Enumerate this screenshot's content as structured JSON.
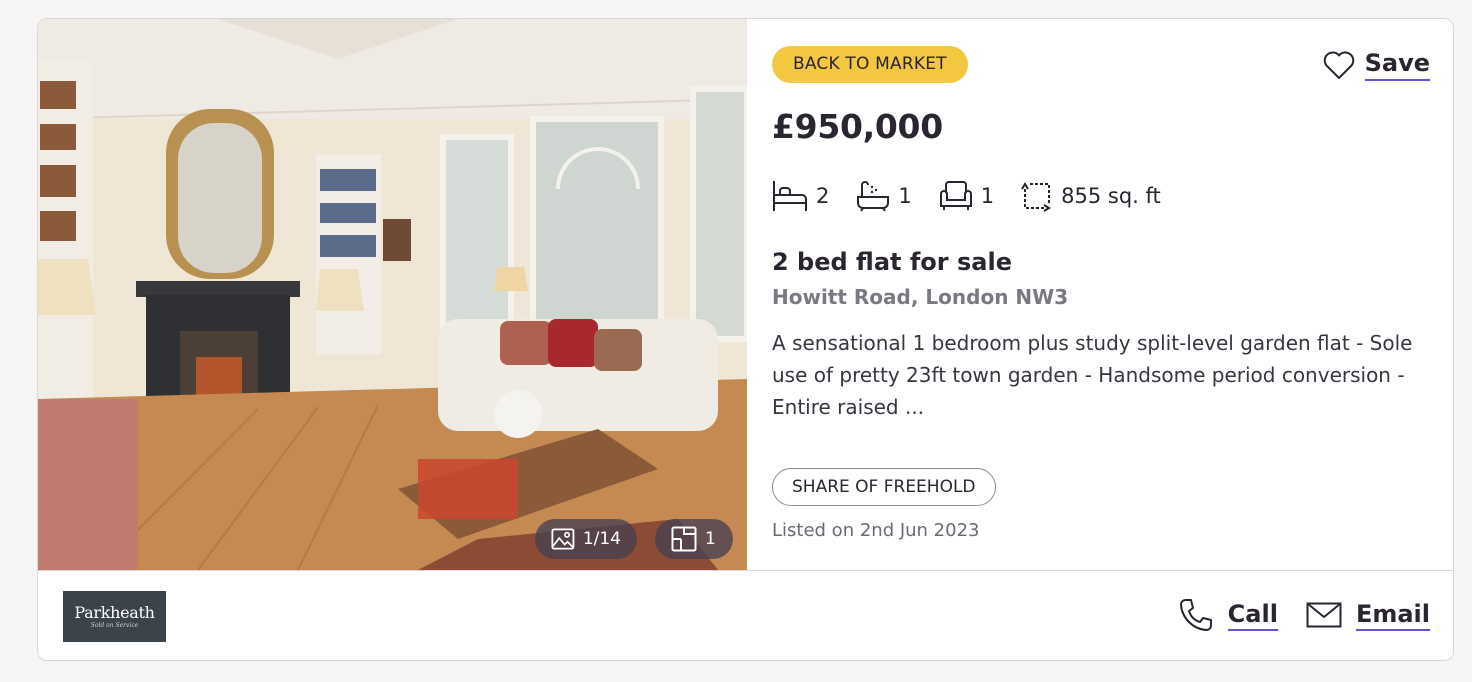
{
  "listing": {
    "badge": "BACK TO MARKET",
    "save_label": "Save",
    "price": "£950,000",
    "features": {
      "bedrooms": "2",
      "bathrooms": "1",
      "receptions": "1",
      "area": "855 sq. ft"
    },
    "title": "2 bed flat for sale",
    "address": "Howitt Road, London NW3",
    "description": "A sensational 1 bedroom plus study split-level garden flat - Sole use of pretty 23ft town garden - Handsome period conversion - Entire raised ...",
    "tenure": "SHARE OF FREEHOLD",
    "listed": "Listed on 2nd Jun 2023"
  },
  "gallery": {
    "photo_count": "1/14",
    "floorplan_count": "1"
  },
  "agent": {
    "logo_name": "Parkheath",
    "logo_tagline": "Sold on Service"
  },
  "actions": {
    "call_label": "Call",
    "email_label": "Email"
  },
  "icons": {
    "save": "heart-icon",
    "bed": "bed-icon",
    "bath": "bath-icon",
    "reception": "armchair-icon",
    "area": "area-icon",
    "photos": "image-icon",
    "floorplan": "floorplan-icon",
    "call": "phone-icon",
    "email": "envelope-icon"
  },
  "colors": {
    "badge": "#f4c740",
    "accent_underline": "#6b4fd8",
    "text": "#2a2530",
    "muted": "#7c7883"
  }
}
